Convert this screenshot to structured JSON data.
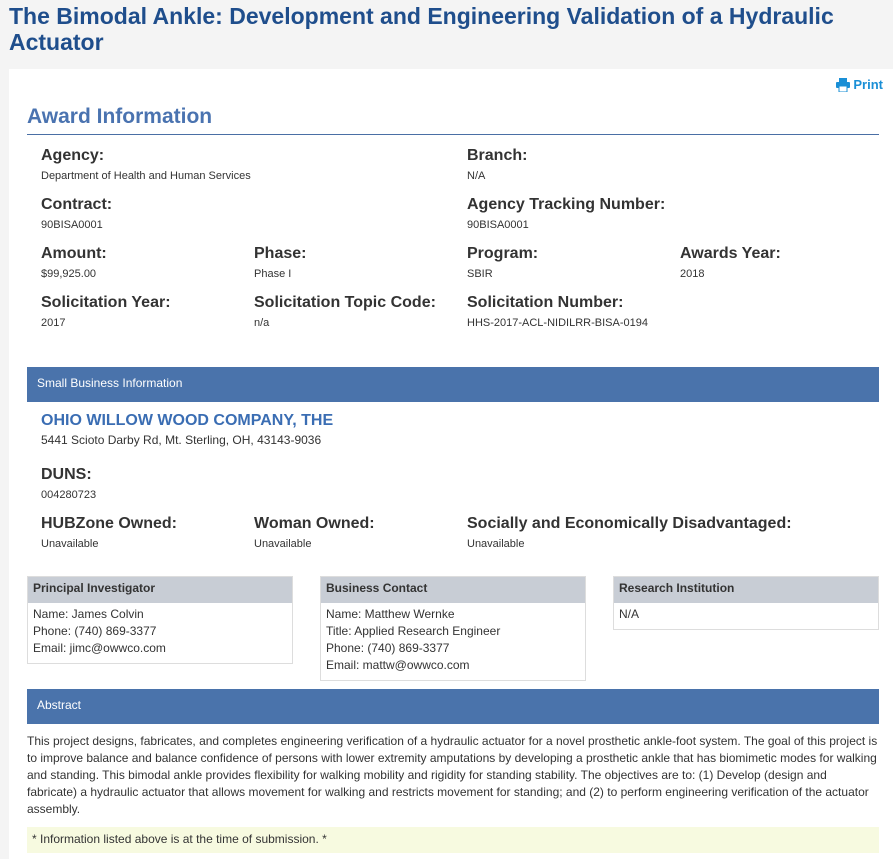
{
  "title": "The Bimodal Ankle: Development and Engineering Validation of a Hydraulic Actuator",
  "print_label": "Print",
  "award": {
    "heading": "Award Information",
    "agency": {
      "label": "Agency:",
      "value": "Department of Health and Human Services"
    },
    "branch": {
      "label": "Branch:",
      "value": "N/A"
    },
    "contract": {
      "label": "Contract:",
      "value": "90BISA0001"
    },
    "tracking": {
      "label": "Agency Tracking Number:",
      "value": "90BISA0001"
    },
    "amount": {
      "label": "Amount:",
      "value": "$99,925.00"
    },
    "phase": {
      "label": "Phase:",
      "value": "Phase I"
    },
    "program": {
      "label": "Program:",
      "value": "SBIR"
    },
    "awards_year": {
      "label": "Awards Year:",
      "value": "2018"
    },
    "sol_year": {
      "label": "Solicitation Year:",
      "value": "2017"
    },
    "sol_topic": {
      "label": "Solicitation Topic Code:",
      "value": "n/a"
    },
    "sol_number": {
      "label": "Solicitation Number:",
      "value": "HHS-2017-ACL-NIDILRR-BISA-0194"
    }
  },
  "business": {
    "heading": "Small Business Information",
    "company": "OHIO WILLOW WOOD COMPANY, THE",
    "address": "5441 Scioto Darby Rd, Mt. Sterling, OH, 43143-9036",
    "duns": {
      "label": "DUNS:",
      "value": "004280723"
    },
    "hubzone": {
      "label": "HUBZone Owned:",
      "value": "Unavailable"
    },
    "woman": {
      "label": "Woman Owned:",
      "value": "Unavailable"
    },
    "disadv": {
      "label": "Socially and Economically Disadvantaged:",
      "value": "Unavailable"
    }
  },
  "pi": {
    "heading": "Principal Investigator",
    "name": "Name: James Colvin",
    "phone": "Phone: (740) 869-3377",
    "email": "Email: jimc@owwco.com"
  },
  "contact": {
    "heading": "Business Contact",
    "name": "Name: Matthew Wernke",
    "title": "Title: Applied Research Engineer",
    "phone": "Phone: (740) 869-3377",
    "email": "Email: mattw@owwco.com"
  },
  "research": {
    "heading": "Research Institution",
    "value": "N/A"
  },
  "abstract": {
    "heading": "Abstract",
    "text": "This project designs, fabricates, and completes engineering verification of a hydraulic actuator for a novel prosthetic ankle-foot system. The goal of this project is to improve balance and balance confidence of persons with lower extremity amputations by developing a prosthetic ankle that has biomimetic modes for walking and standing. This bimodal ankle provides flexibility for walking mobility and rigidity for standing stability. The objectives are to: (1) Develop (design and fabricate) a hydraulic actuator that allows movement for walking and restricts movement for standing; and (2) to perform engineering verification of the actuator assembly."
  },
  "note": "* Information listed above is at the time of submission. *"
}
